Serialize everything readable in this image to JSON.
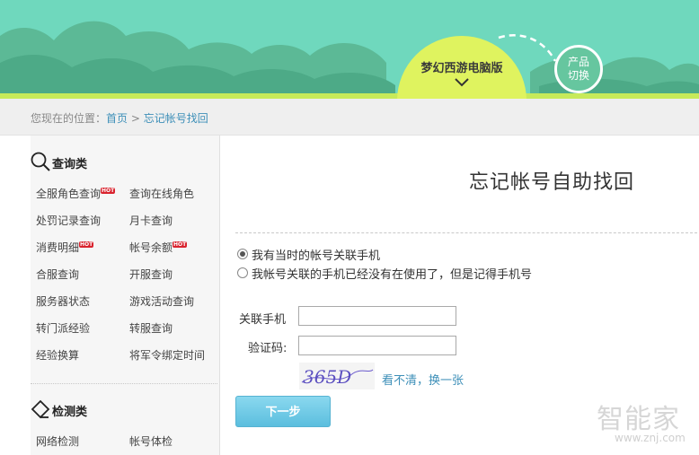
{
  "header": {
    "product_title": "梦幻西游电脑版",
    "switch_line1": "产品",
    "switch_line2": "切换"
  },
  "breadcrumb": {
    "prefix": "您现在的位置：",
    "home": "首页",
    "separator": " > ",
    "current": "忘记帐号找回"
  },
  "sidebar": {
    "query_title": "查询类",
    "query_items": [
      {
        "label": "全服角色查询",
        "hot": "HOT"
      },
      {
        "label": "查询在线角色"
      },
      {
        "label": "处罚记录查询"
      },
      {
        "label": "月卡查询"
      },
      {
        "label": "消费明细",
        "hot": "HOT"
      },
      {
        "label": "帐号余额",
        "hot": "HOT"
      },
      {
        "label": "合服查询"
      },
      {
        "label": "开服查询"
      },
      {
        "label": "服务器状态"
      },
      {
        "label": "游戏活动查询"
      },
      {
        "label": "转门派经验"
      },
      {
        "label": "转服查询"
      },
      {
        "label": "经验换算"
      },
      {
        "label": "将军令绑定时间"
      }
    ],
    "detect_title": "检测类",
    "detect_items": [
      {
        "label": "网络检测"
      },
      {
        "label": "帐号体检"
      }
    ]
  },
  "main": {
    "title": "忘记帐号自助找回",
    "option1": "我有当时的帐号关联手机",
    "option2": "我帐号关联的手机已经没有在使用了，但是记得手机号",
    "phone_label": "关联手机",
    "phone_value": "",
    "code_label": "验证码:",
    "code_value": "",
    "captcha_text": "365D",
    "refresh_label": "看不清，换一张",
    "next_button": "下一步"
  },
  "watermark": {
    "text": "智能家",
    "url": "www.znj.com"
  }
}
